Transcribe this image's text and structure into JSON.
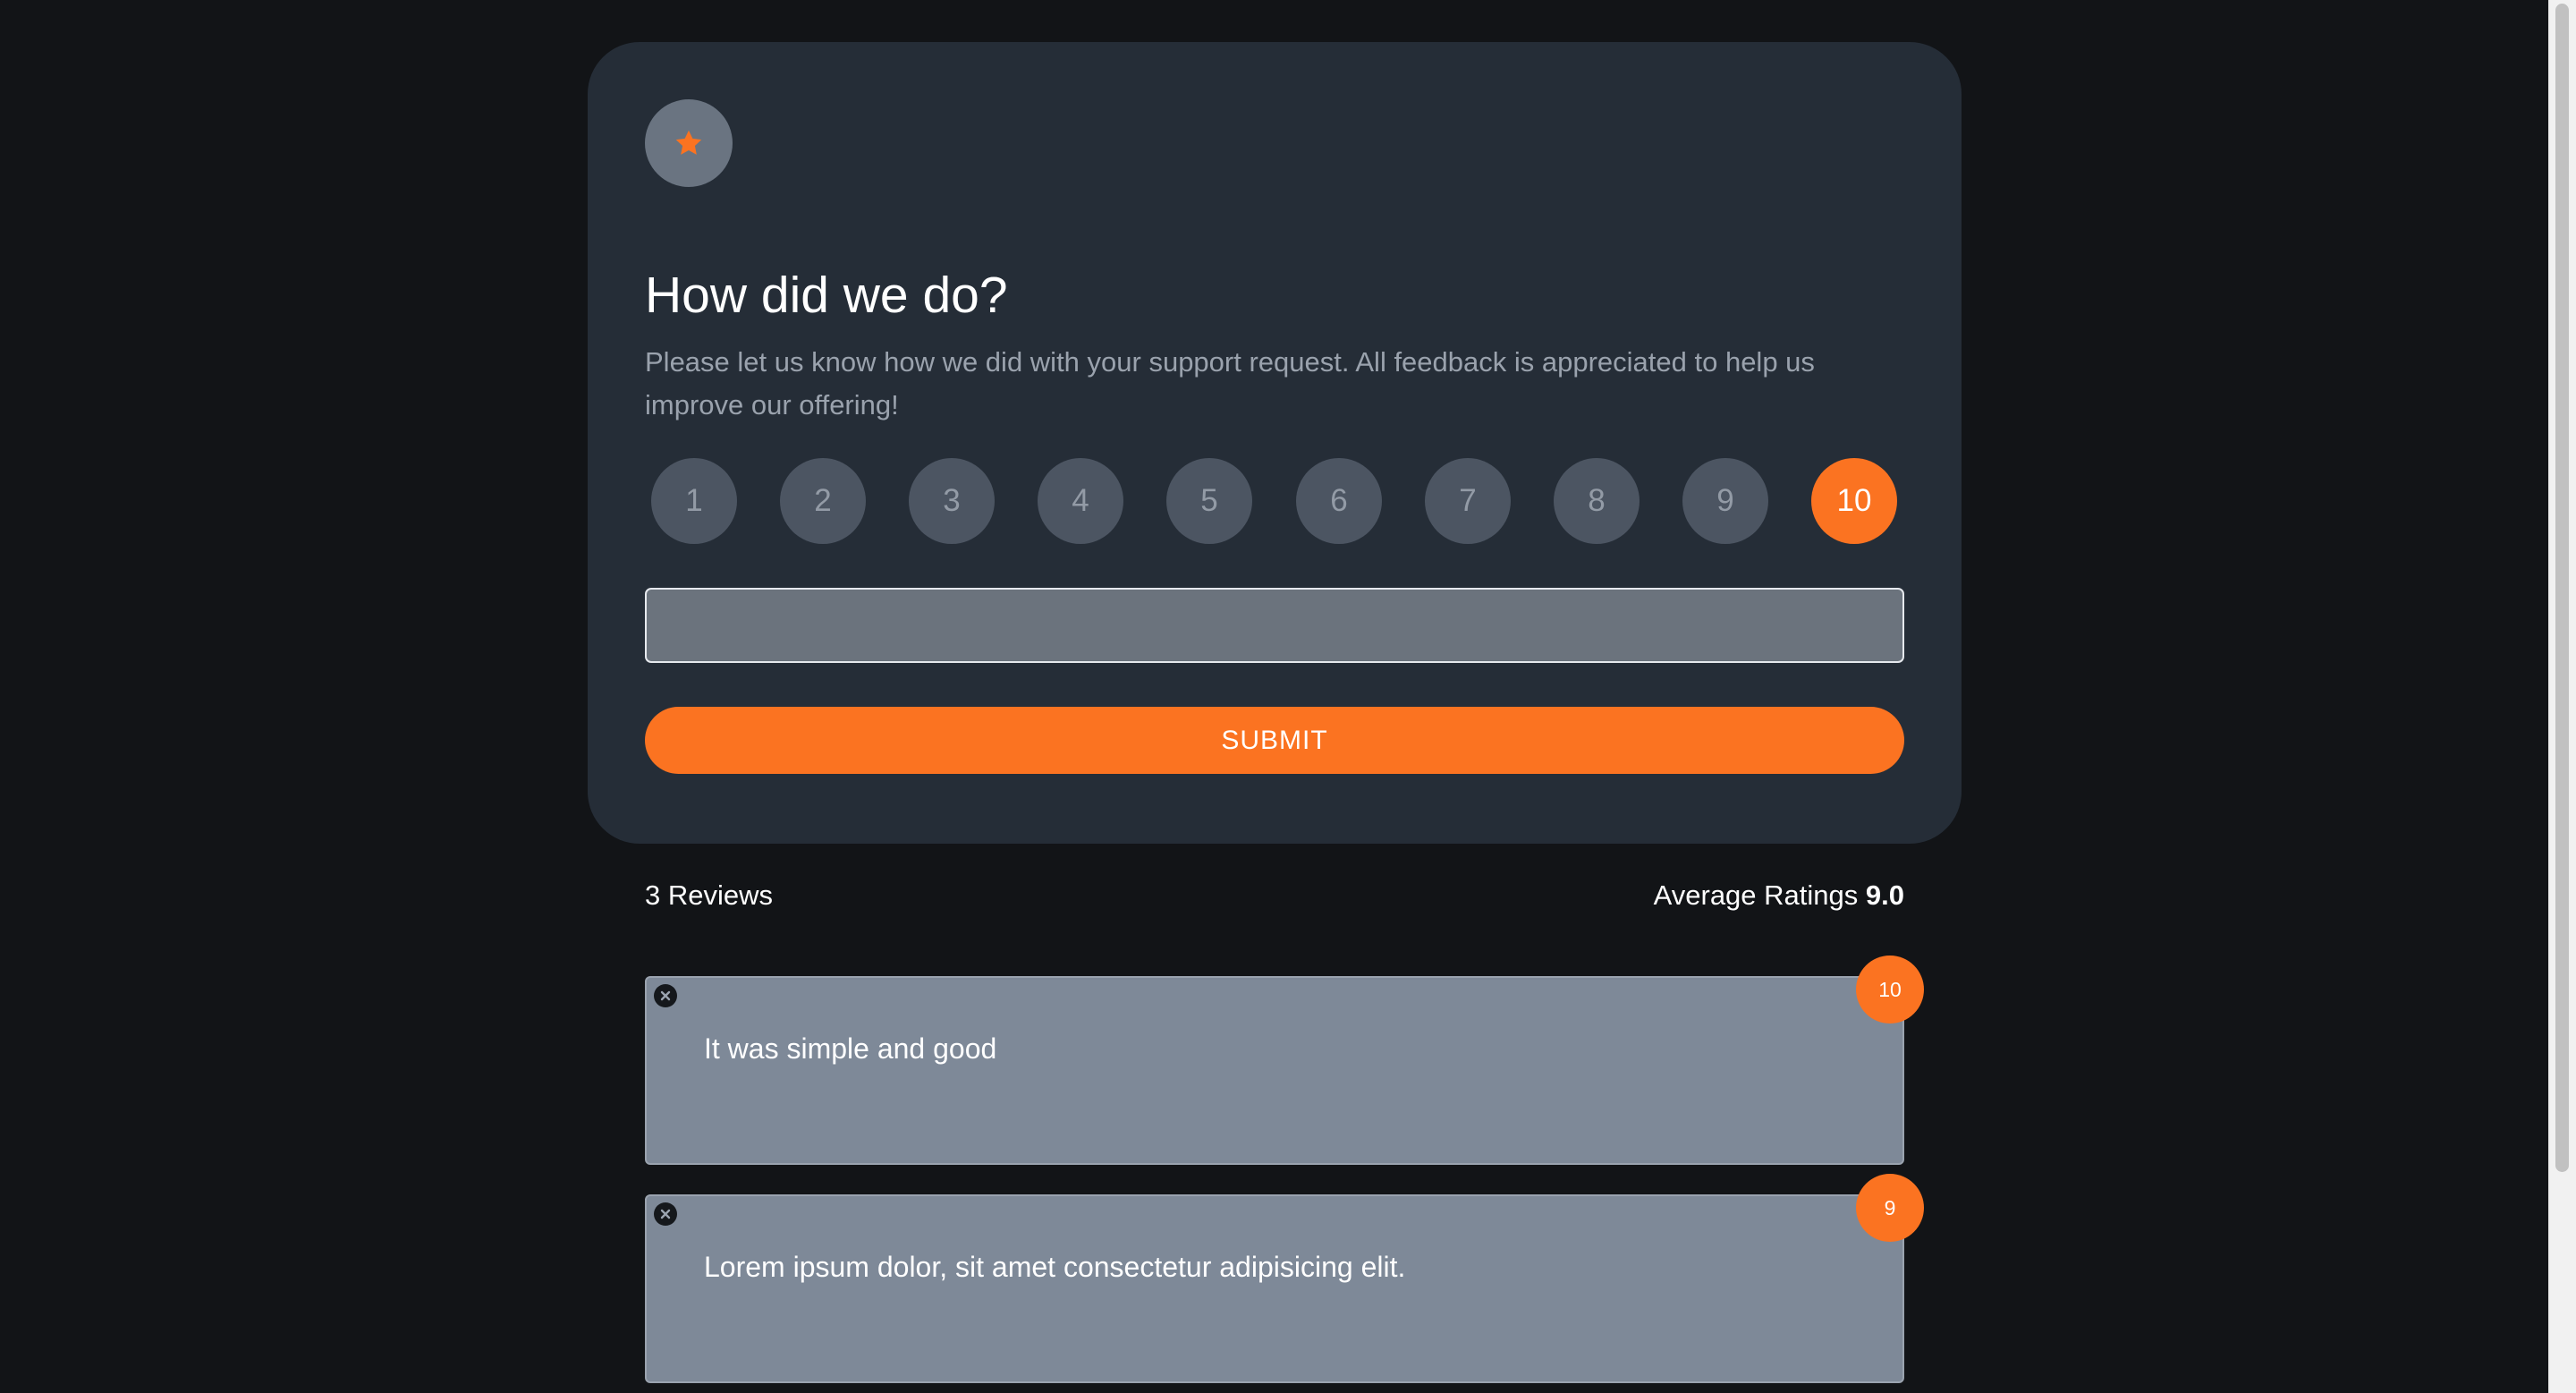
{
  "card": {
    "icon": "star-icon",
    "title": "How did we do?",
    "description": "Please let us know how we did with your support request. All feedback is appreciated to help us improve our offering!",
    "ratings": [
      "1",
      "2",
      "3",
      "4",
      "5",
      "6",
      "7",
      "8",
      "9",
      "10"
    ],
    "selected_rating": "10",
    "review_input": {
      "value": "",
      "placeholder": ""
    },
    "submit_label": "SUBMIT"
  },
  "stats": {
    "count_label": "3 Reviews",
    "average_label": "Average Ratings",
    "average_value": "9.0"
  },
  "reviews": [
    {
      "text": "It was simple and good",
      "rating": "10"
    },
    {
      "text": "Lorem ipsum dolor, sit amet consectetur adipisicing elit.",
      "rating": "9"
    }
  ],
  "colors": {
    "background": "#121417",
    "card": "#252d37",
    "accent": "#fb7321",
    "rating_button": "#4c5562",
    "review_card": "#7e8998"
  }
}
